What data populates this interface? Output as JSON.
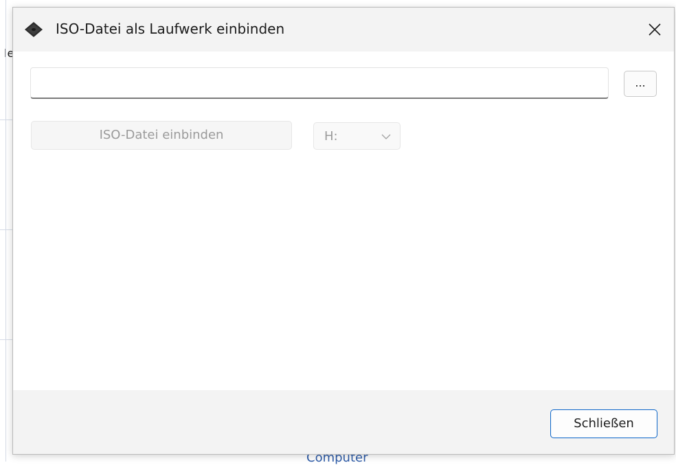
{
  "background": {
    "left_fragment": "le",
    "bottom_fragment": "Computer"
  },
  "dialog": {
    "title": "ISO-Datei als Laufwerk einbinden",
    "icon": "disc-image-icon",
    "close_icon": "close-icon",
    "path_input": {
      "value": "",
      "placeholder": ""
    },
    "browse_label": "...",
    "mount_label": "ISO-Datei einbinden",
    "drive_select": {
      "selected": "H:"
    },
    "footer": {
      "close_label": "Schließen"
    }
  },
  "colors": {
    "accent": "#0a64c8",
    "titlebar": "#f3f3f3",
    "footer": "#f3f3f3"
  }
}
